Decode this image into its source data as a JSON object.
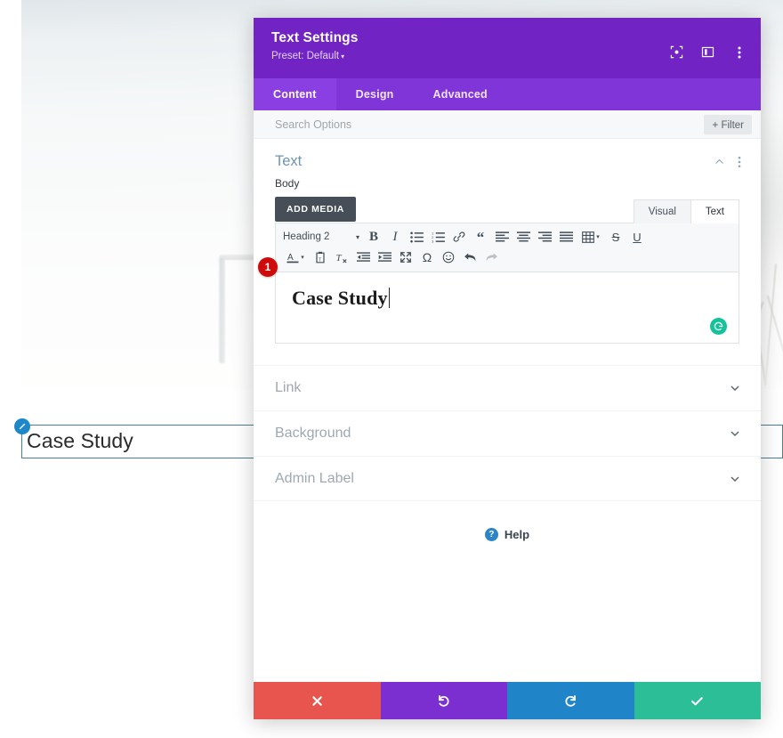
{
  "preview": {
    "module_text": "Case Study",
    "edit_badge_icon": "pencil-icon"
  },
  "modal": {
    "title": "Text Settings",
    "preset_label": "Preset: Default",
    "preset_caret": "▾",
    "header_icons": [
      {
        "name": "focus-icon"
      },
      {
        "name": "layout-columns-icon"
      },
      {
        "name": "more-vertical-icon"
      }
    ],
    "tabs": [
      {
        "label": "Content",
        "active": true
      },
      {
        "label": "Design",
        "active": false
      },
      {
        "label": "Advanced",
        "active": false
      }
    ],
    "search": {
      "placeholder": "Search Options",
      "value": ""
    },
    "filter_button": {
      "plus": "+",
      "label": "Filter"
    },
    "section": {
      "title": "Text",
      "collapse_icon": "chevron-up-icon",
      "more_icon": "more-vertical-icon"
    },
    "body_field": {
      "label": "Body",
      "add_media_label": "ADD MEDIA"
    },
    "editor_tabs": [
      {
        "label": "Visual",
        "active": false
      },
      {
        "label": "Text",
        "active": true
      }
    ],
    "toolbar_row1": [
      {
        "name": "format-select",
        "label": "Heading 2",
        "type": "select",
        "caret": "▾"
      },
      {
        "name": "bold-button",
        "glyph": "B",
        "type": "text-bold"
      },
      {
        "name": "italic-button",
        "glyph": "I",
        "type": "text-italic"
      },
      {
        "name": "bulleted-list-button",
        "type": "icon-ul"
      },
      {
        "name": "numbered-list-button",
        "type": "icon-ol"
      },
      {
        "name": "link-button",
        "type": "icon-link"
      },
      {
        "name": "blockquote-button",
        "glyph": "“",
        "type": "text-quote"
      },
      {
        "name": "align-left-button",
        "type": "icon-align-left"
      },
      {
        "name": "align-center-button",
        "type": "icon-align-center"
      },
      {
        "name": "align-right-button",
        "type": "icon-align-right"
      },
      {
        "name": "align-justify-button",
        "type": "icon-align-justify"
      },
      {
        "name": "table-button",
        "type": "icon-table",
        "caret": "▾"
      },
      {
        "name": "strikethrough-button",
        "glyph": "S",
        "type": "text-strike"
      },
      {
        "name": "underline-button",
        "glyph": "U",
        "type": "text-under"
      }
    ],
    "toolbar_row2": [
      {
        "name": "text-color-button",
        "glyph": "A",
        "type": "text-color",
        "caret": "▾"
      },
      {
        "name": "paste-as-text-button",
        "type": "icon-paste"
      },
      {
        "name": "clear-formatting-button",
        "type": "icon-clear-format"
      },
      {
        "name": "outdent-button",
        "type": "icon-outdent"
      },
      {
        "name": "indent-button",
        "type": "icon-indent"
      },
      {
        "name": "fullscreen-button",
        "type": "icon-fullscreen"
      },
      {
        "name": "special-character-button",
        "glyph": "Ω",
        "type": "text-omega"
      },
      {
        "name": "emoji-button",
        "type": "icon-emoji"
      },
      {
        "name": "undo-button",
        "type": "icon-undo"
      },
      {
        "name": "redo-button",
        "type": "icon-redo",
        "dim": true
      }
    ],
    "editor": {
      "content": "Case Study",
      "step_badge": "1",
      "grammarly_icon": "grammarly-icon"
    },
    "accordions": [
      {
        "label": "Link"
      },
      {
        "label": "Background"
      },
      {
        "label": "Admin Label"
      }
    ],
    "help": {
      "icon_glyph": "?",
      "label": "Help"
    },
    "footer_buttons": [
      {
        "name": "cancel-button",
        "icon": "close-icon",
        "color": "#e8544e"
      },
      {
        "name": "undo-button",
        "icon": "undo-icon",
        "color": "#7b2fd1"
      },
      {
        "name": "redo-button",
        "icon": "redo-icon",
        "color": "#2084c9"
      },
      {
        "name": "save-button",
        "icon": "check-icon",
        "color": "#2cbe96"
      }
    ]
  }
}
